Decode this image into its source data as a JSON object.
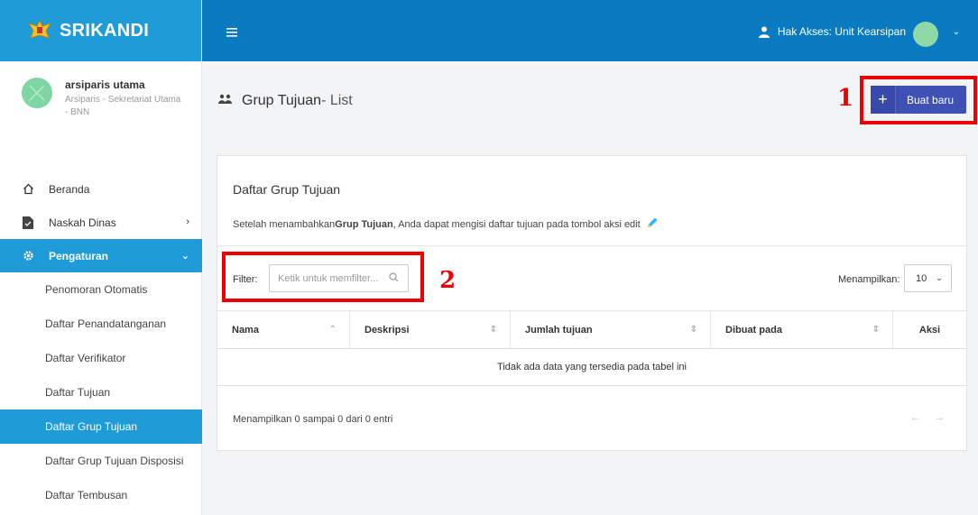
{
  "brand": {
    "name": "SRIKANDI"
  },
  "user": {
    "name": "arsiparis utama",
    "subtitle": "Arsiparis - Sekretariat Utama - BNN"
  },
  "menu": {
    "items": [
      {
        "label": "Beranda",
        "icon": "home-icon"
      },
      {
        "label": "Naskah Dinas",
        "icon": "document-icon",
        "chevron": "›"
      },
      {
        "label": "Pengaturan",
        "icon": "gear-icon",
        "chevron": "⌄"
      }
    ],
    "sub_items": [
      {
        "label": "Penomoran Otomatis"
      },
      {
        "label": "Daftar Penandatanganan"
      },
      {
        "label": "Daftar Verifikator"
      },
      {
        "label": "Daftar Tujuan"
      },
      {
        "label": "Daftar Grup Tujuan"
      },
      {
        "label": "Daftar Grup Tujuan Disposisi"
      },
      {
        "label": "Daftar Tembusan"
      }
    ]
  },
  "topbar": {
    "access": "Hak Akses: Unit Kearsipan"
  },
  "page": {
    "title_main": "Grup Tujuan",
    "title_sub": " - List",
    "new_button": "Buat baru"
  },
  "annotations": {
    "one": "1",
    "two": "2"
  },
  "card": {
    "title": "Daftar Grup Tujuan",
    "desc_pre": "Setelah menambahkan ",
    "desc_bold": "Grup Tujuan",
    "desc_post": ", Anda dapat mengisi daftar tujuan pada tombol aksi edit"
  },
  "filter": {
    "label": "Filter:",
    "placeholder": "Ketik untuk memfilter..."
  },
  "show": {
    "label": "Menampilkan:",
    "value": "10"
  },
  "table": {
    "columns": [
      {
        "label": "Nama",
        "sort": "⌃"
      },
      {
        "label": "Deskripsi",
        "sort": "⇕"
      },
      {
        "label": "Jumlah tujuan",
        "sort": "⇕"
      },
      {
        "label": "Dibuat pada",
        "sort": "⇕"
      },
      {
        "label": "Aksi",
        "sort": ""
      }
    ],
    "empty": "Tidak ada data yang tersedia pada tabel ini"
  },
  "footer": {
    "info": "Menampilkan 0 sampai 0 dari 0 entri",
    "prev": "←",
    "next": "→"
  },
  "colors": {
    "brand": "#1f9bd7",
    "topbar": "#0b7bc1",
    "primary_button": "#3f51b5",
    "annotation": "#ee0000"
  }
}
